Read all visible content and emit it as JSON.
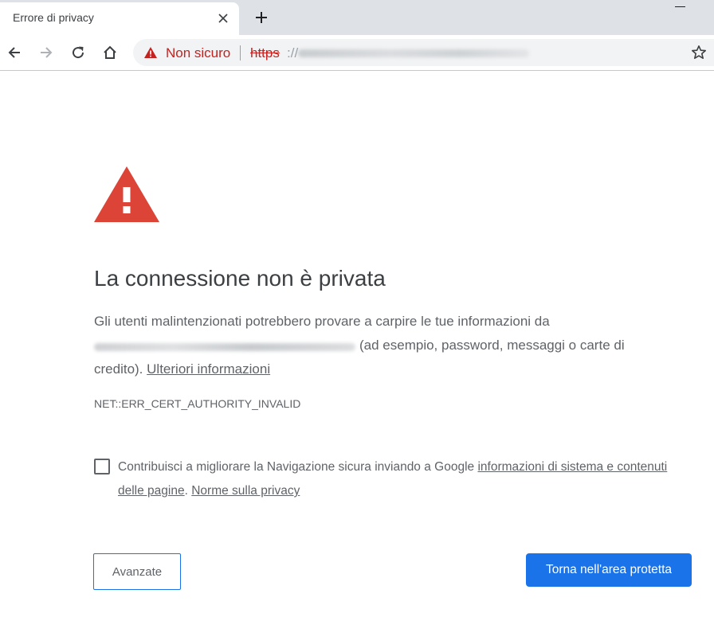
{
  "browser": {
    "tab_title": "Errore di privacy",
    "omnibox": {
      "security_label": "Non sicuro",
      "separator": "|",
      "url_scheme": "https",
      "url_separator": "://"
    }
  },
  "interstitial": {
    "heading": "La connessione non è privata",
    "explanation_line1": "Gli utenti malintenzionati potrebbero provare a carpire le tue informazioni da",
    "explanation_line2_suffix": "(ad esempio, password, messaggi o carte di",
    "explanation_line3_prefix": "credito).",
    "learn_more_link": "Ulteriori informazioni",
    "error_code": "NET::ERR_CERT_AUTHORITY_INVALID",
    "optin": {
      "text_prefix": "Contribuisci a migliorare la Navigazione sicura inviando a Google",
      "system_info_link": "informazioni di sistema e contenuti delle pagine",
      "separator": ".",
      "privacy_link": "Norme sulla privacy",
      "checked": false
    },
    "advanced_button": "Avanzate",
    "back_button": "Torna nell'area protetta"
  },
  "colors": {
    "warning_red": "#db4437",
    "not_secure_red": "#c5221f",
    "primary_blue": "#1a73e8",
    "body_text": "#5f6368",
    "tabstrip_bg": "#dee1e6"
  },
  "icons": {
    "tab_close": "close-icon",
    "new_tab": "plus-icon",
    "back": "arrow-left-icon",
    "forward": "arrow-right-icon",
    "reload": "reload-icon",
    "home": "home-icon",
    "security": "warning-triangle-icon",
    "bookmark": "star-icon",
    "interstitial": "alert-triangle-icon"
  }
}
